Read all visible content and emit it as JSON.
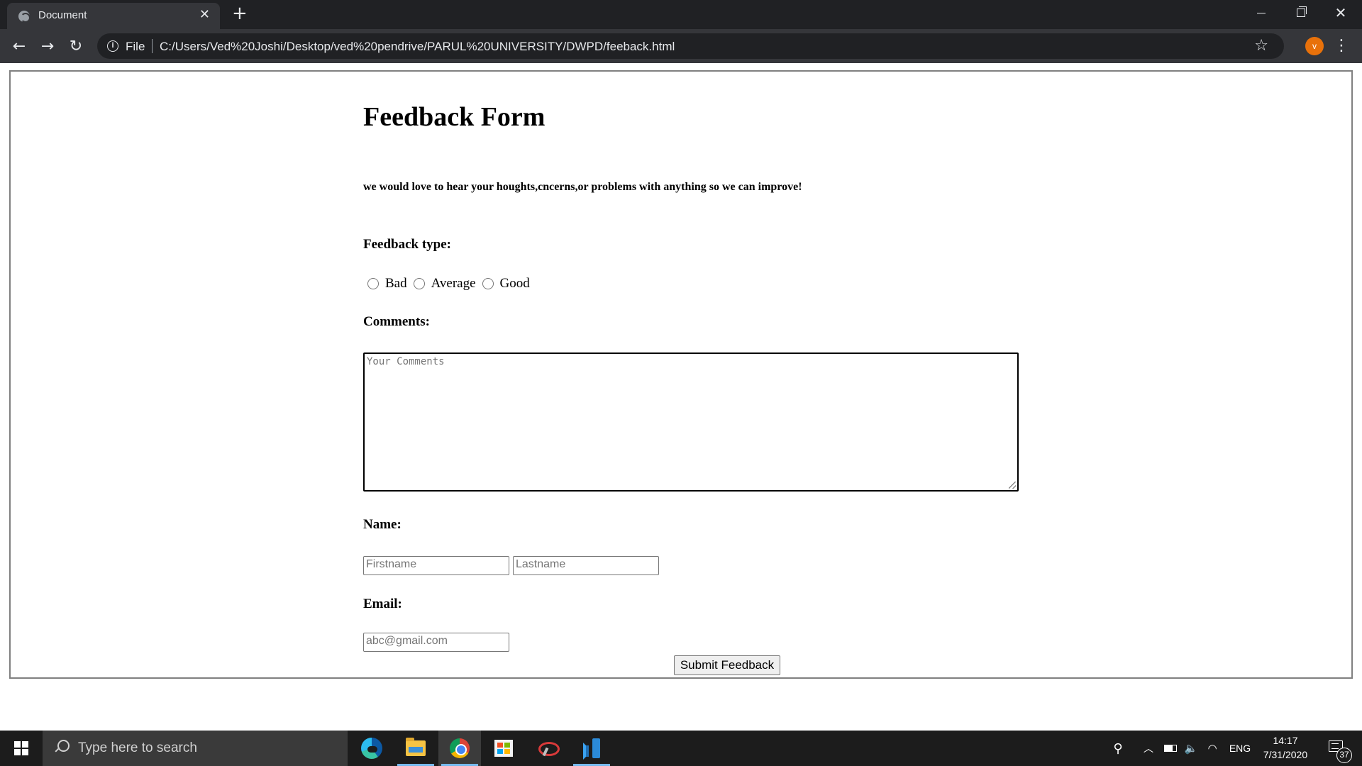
{
  "browser": {
    "tab_title": "Document",
    "tab_close_glyph": "✕",
    "new_tab_glyph": "+",
    "address_scheme_label": "File",
    "address_url": "C:/Users/Ved%20Joshi/Desktop/ved%20pendrive/PARUL%20UNIVERSITY/DWPD/feeback.html",
    "profile_initial": "v",
    "profile_color": "#e8710a",
    "icons": [
      "back-icon",
      "forward-icon",
      "reload-icon",
      "info-icon",
      "star-icon",
      "menu-icon"
    ]
  },
  "form": {
    "title": "Feedback Form",
    "intro": "we would love to hear your houghts,cncerns,or problems with anything so we can improve!",
    "feedback_type_label": "Feedback type:",
    "feedback_options": [
      "Bad",
      "Average",
      "Good"
    ],
    "comments_label": "Comments:",
    "comments_placeholder": "Your Comments",
    "name_label": "Name:",
    "firstname_placeholder": "Firstname",
    "lastname_placeholder": "Lastname",
    "email_label": "Email:",
    "email_placeholder": "abc@gmail.com",
    "submit_label": "Submit Feedback"
  },
  "taskbar": {
    "search_placeholder": "Type here to search",
    "pinned_apps": [
      "edge-icon",
      "file-explorer-icon",
      "chrome-icon",
      "microsoft-store-icon",
      "snip-sketch-icon",
      "vscode-icon"
    ],
    "active_app": "chrome-icon",
    "language": "ENG",
    "time": "14:17",
    "date": "7/31/2020",
    "notification_count": "37"
  }
}
